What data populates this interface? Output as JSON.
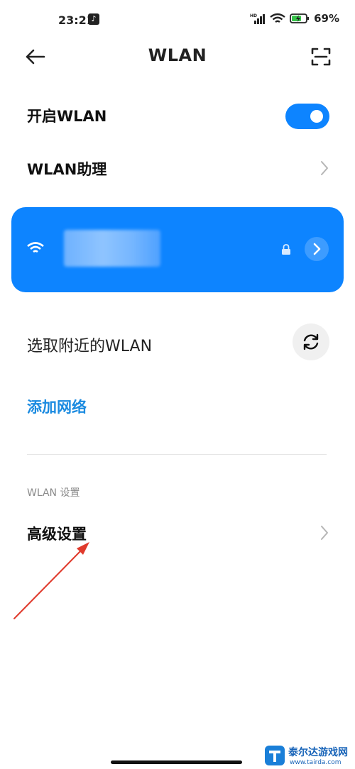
{
  "status_bar": {
    "time": "23:21",
    "app_icon": "tiktok-icon",
    "network_badge": "HD",
    "battery_text": "69%"
  },
  "nav": {
    "title": "WLAN",
    "back_icon": "back-arrow-icon",
    "scan_icon": "scan-icon"
  },
  "wlan_toggle": {
    "label": "开启WLAN",
    "enabled": true
  },
  "wlan_assistant": {
    "label": "WLAN助理"
  },
  "connected_network": {
    "accent_color": "#0d84ff"
  },
  "nearby": {
    "label": "选取附近的WLAN"
  },
  "add_network": {
    "label": "添加网络",
    "color": "#1a8ae0"
  },
  "settings_section": {
    "header": "WLAN 设置",
    "advanced_label": "高级设置"
  },
  "watermark": {
    "name": "泰尔达游戏网",
    "url": "www.tairda.com"
  }
}
